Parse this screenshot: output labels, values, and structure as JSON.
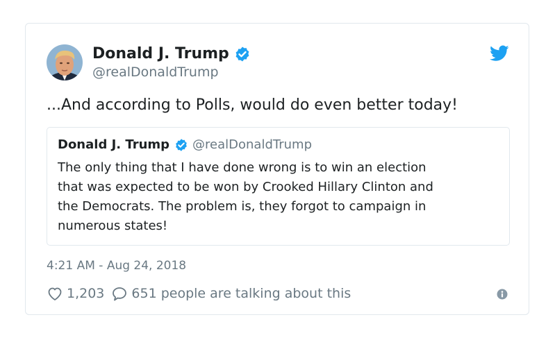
{
  "tweet": {
    "author_name": "Donald J. Trump",
    "author_handle": "@realDonaldTrump",
    "text": "...And according to Polls, would do even better today!",
    "quoted": {
      "author_name": "Donald J. Trump",
      "author_handle": "@realDonaldTrump",
      "text_lines": [
        "The only thing that I have done wrong is to win an election",
        "that was expected to be won by Crooked Hillary Clinton and",
        "the Democrats. The problem is, they forgot to campaign in",
        "numerous states!"
      ]
    },
    "timestamp": "4:21 AM - Aug 24, 2018",
    "like_count": "1,203",
    "talk_text": "651 people are talking about this"
  },
  "icons": {
    "avatar": "avatar-photo",
    "verified": "verified-badge-icon",
    "twitter": "twitter-bird-icon",
    "heart": "heart-icon",
    "comment": "comment-icon",
    "info": "info-icon"
  },
  "colors": {
    "twitter_blue": "#1da1f2",
    "secondary_text": "#697882",
    "border": "#e1e8ed"
  }
}
